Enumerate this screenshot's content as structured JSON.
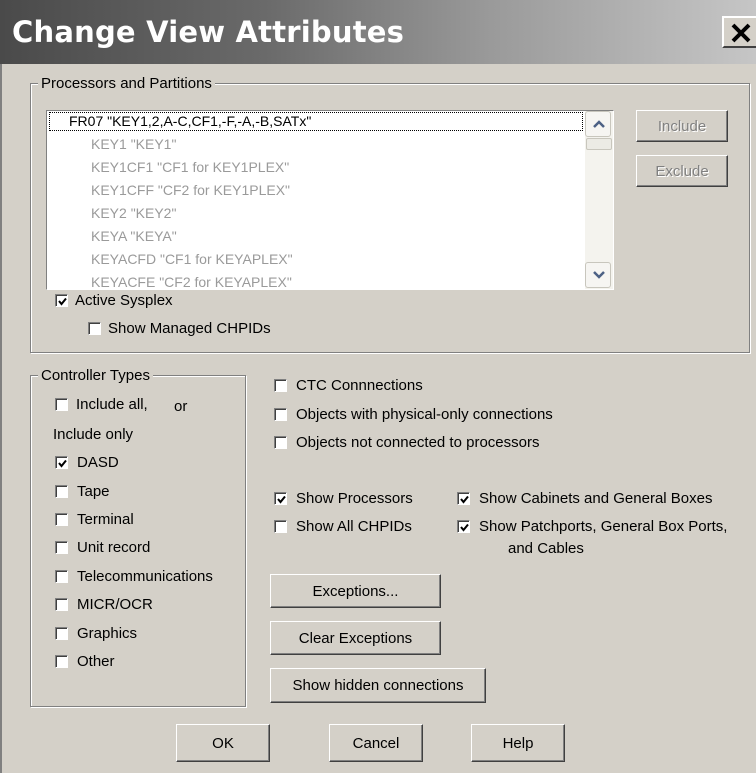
{
  "window": {
    "title": "Change View Attributes"
  },
  "processors": {
    "legend": "Processors and Partitions",
    "items": [
      "FR07 \"KEY1,2,A-C,CF1,-F,-A,-B,SATx\"",
      "KEY1 \"KEY1\"",
      "KEY1CF1 \"CF1 for KEY1PLEX\"",
      "KEY1CFF \"CF2 for KEY1PLEX\"",
      "KEY2 \"KEY2\"",
      "KEYA \"KEYA\"",
      "KEYACFD \"CF1 for KEYAPLEX\"",
      "KEYACFE \"CF2 for KEYAPLEX\""
    ],
    "include_label": "Include",
    "exclude_label": "Exclude",
    "active_sysplex": {
      "label": "Active Sysplex",
      "checked": true
    },
    "show_managed_chpids": {
      "label": "Show Managed CHPIDs",
      "checked": false
    }
  },
  "controller_types": {
    "legend": "Controller Types",
    "include_all": {
      "label": "Include all,",
      "checked": false
    },
    "or_label": "or",
    "include_only_label": "Include only",
    "items": [
      {
        "label": "DASD",
        "checked": true
      },
      {
        "label": "Tape",
        "checked": false
      },
      {
        "label": "Terminal",
        "checked": false
      },
      {
        "label": "Unit record",
        "checked": false
      },
      {
        "label": "Telecommunications",
        "checked": false
      },
      {
        "label": "MICR/OCR",
        "checked": false
      },
      {
        "label": "Graphics",
        "checked": false
      },
      {
        "label": "Other",
        "checked": false
      }
    ]
  },
  "options": {
    "ctc_connections": {
      "label": "CTC Connnections",
      "checked": false
    },
    "physical_only": {
      "label": "Objects with physical-only connections",
      "checked": false
    },
    "not_connected": {
      "label": "Objects not connected to processors",
      "checked": false
    },
    "show_processors": {
      "label": "Show Processors",
      "checked": true
    },
    "show_all_chpids": {
      "label": "Show All CHPIDs",
      "checked": false
    },
    "show_cabinets": {
      "label": "Show Cabinets and General Boxes",
      "checked": true
    },
    "show_patchports": {
      "label_line1": "Show Patchports, General Box Ports,",
      "label_line2": "and Cables",
      "checked": true
    }
  },
  "buttons": {
    "exceptions": "Exceptions...",
    "clear_exceptions": "Clear Exceptions",
    "show_hidden": "Show hidden connections",
    "ok": "OK",
    "cancel": "Cancel",
    "help": "Help"
  }
}
